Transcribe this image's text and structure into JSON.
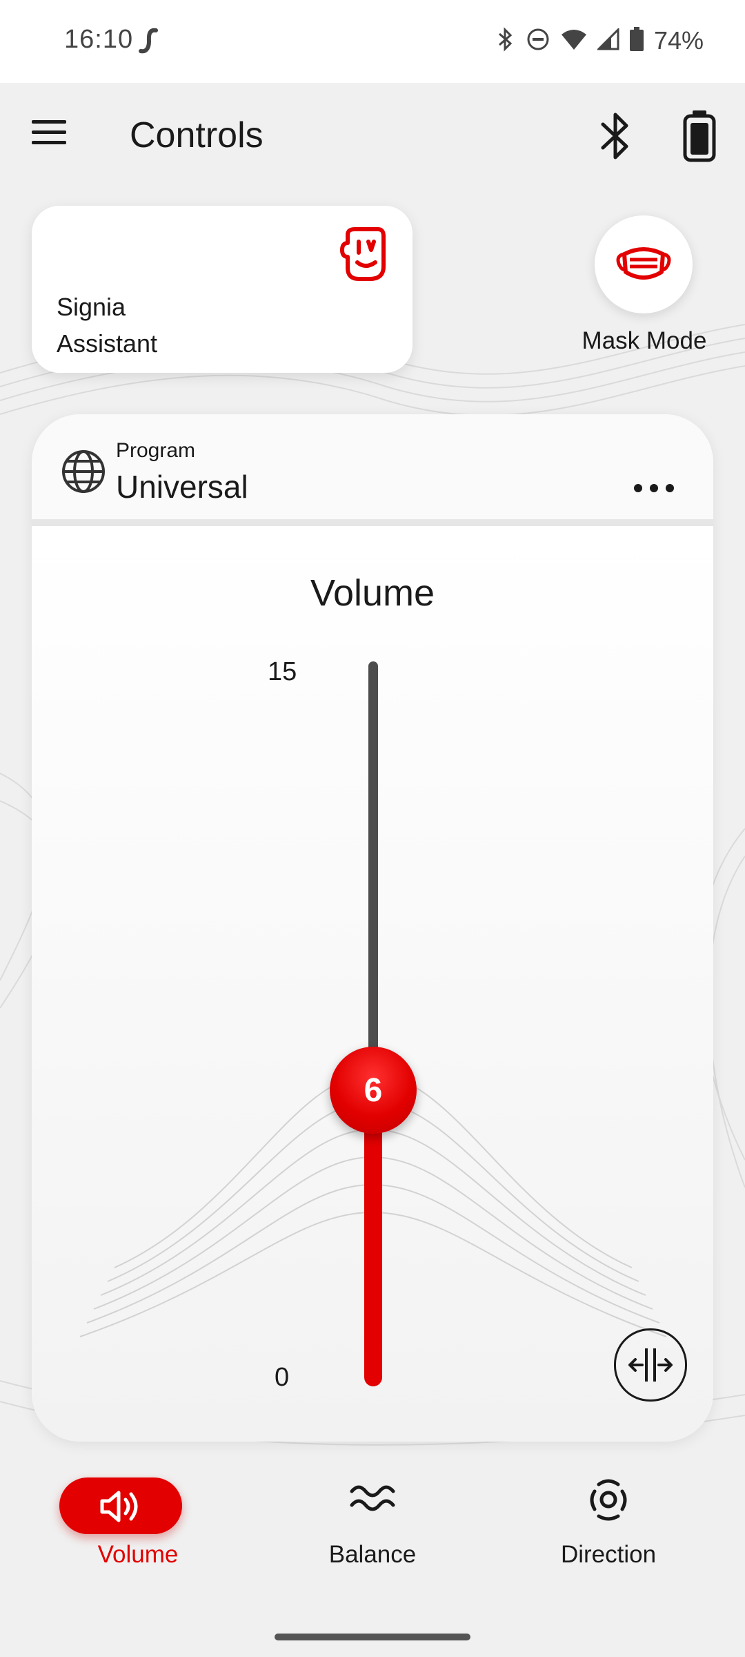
{
  "status_bar": {
    "time": "16:10",
    "battery_percent": "74%",
    "icons": [
      "signia-logo-icon",
      "bluetooth-icon",
      "do-not-disturb-icon",
      "wifi-icon",
      "cell-signal-icon",
      "battery-icon"
    ]
  },
  "header": {
    "title": "Controls",
    "menu_icon": "hamburger-menu-icon",
    "right_icons": [
      "bluetooth-icon",
      "hearing-aid-battery-icon"
    ]
  },
  "assistant_card": {
    "label_line1": "Signia",
    "label_line2": "Assistant",
    "icon": "assistant-face-icon"
  },
  "mask_mode": {
    "label": "Mask Mode",
    "icon": "face-mask-icon"
  },
  "program": {
    "kicker": "Program",
    "name": "Universal",
    "icon": "globe-icon",
    "more_icon": "more-horizontal-icon"
  },
  "volume": {
    "title": "Volume",
    "max": "15",
    "min": "0",
    "value": "6",
    "split_icon": "split-left-right-icon"
  },
  "bottom_nav": {
    "items": [
      {
        "label": "Volume",
        "icon": "speaker-icon",
        "active": true
      },
      {
        "label": "Balance",
        "icon": "balance-waves-icon",
        "active": false
      },
      {
        "label": "Direction",
        "icon": "direction-icon",
        "active": false
      }
    ]
  },
  "colors": {
    "accent": "#e20000",
    "track": "#4d4d4d",
    "background": "#f0f0f0"
  }
}
